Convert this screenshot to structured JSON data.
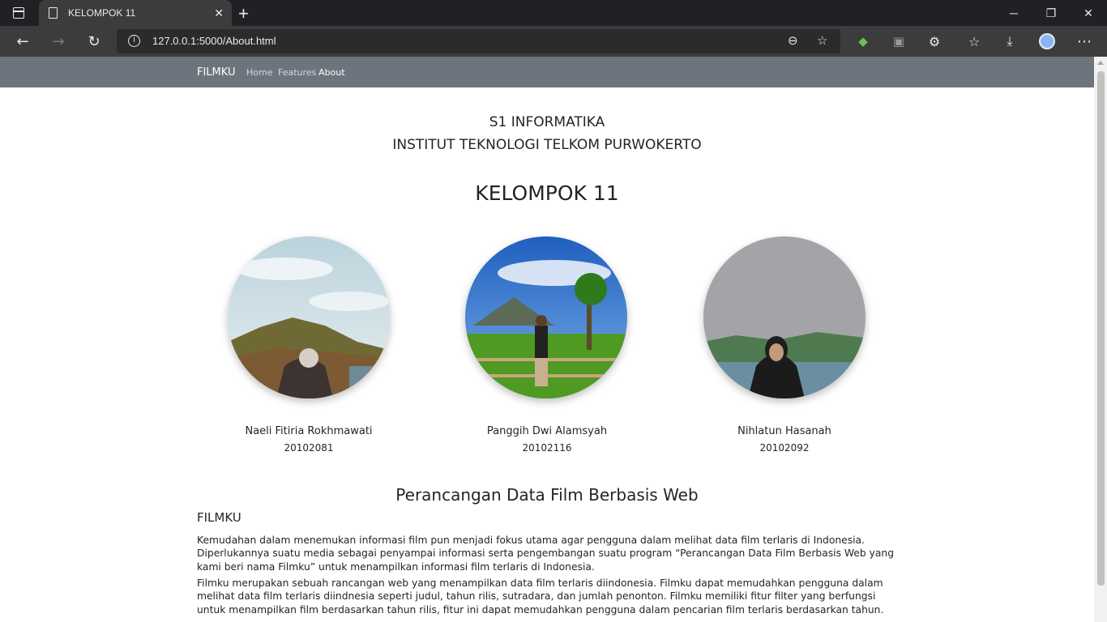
{
  "browser": {
    "tab_title": "KELOMPOK 11",
    "url": "127.0.0.1:5000/About.html"
  },
  "navbar": {
    "brand": "FILMKU",
    "links": [
      {
        "label": "Home",
        "active": false
      },
      {
        "label": "Features",
        "active": false
      },
      {
        "label": "About",
        "active": true
      }
    ]
  },
  "header": {
    "line1": "S1 INFORMATIKA",
    "line2": "INSTITUT TEKNOLOGI TELKOM PURWOKERTO",
    "group": "KELOMPOK 11"
  },
  "members": [
    {
      "name": "Naeli Fitiria Rokhmawati",
      "nim": "20102081"
    },
    {
      "name": "Panggih Dwi Alamsyah",
      "nim": "20102116"
    },
    {
      "name": "Nihlatun Hasanah",
      "nim": "20102092"
    }
  ],
  "about": {
    "title": "Perancangan Data Film Berbasis Web",
    "subtitle": "FILMKU",
    "paragraph1": "Kemudahan dalam menemukan informasi film pun menjadi fokus utama agar pengguna dalam melihat data film terlaris di Indonesia. Diperlukannya suatu media sebagai penyampai informasi serta pengembangan suatu program “Perancangan Data Film Berbasis Web yang kami beri nama Filmku” untuk menampilkan informasi film terlaris di Indonesia.",
    "paragraph2": "Filmku merupakan sebuah rancangan web yang menampilkan data film terlaris diindonesia. Filmku dapat memudahkan pengguna dalam melihat data film terlaris diindnesia seperti judul, tahun rilis, sutradara, dan jumlah penonton. Filmku memiliki fitur filter yang berfungsi untuk menampilkan film berdasarkan tahun rilis, fitur ini dapat memudahkan pengguna dalam pencarian film terlaris berdasarkan tahun."
  }
}
